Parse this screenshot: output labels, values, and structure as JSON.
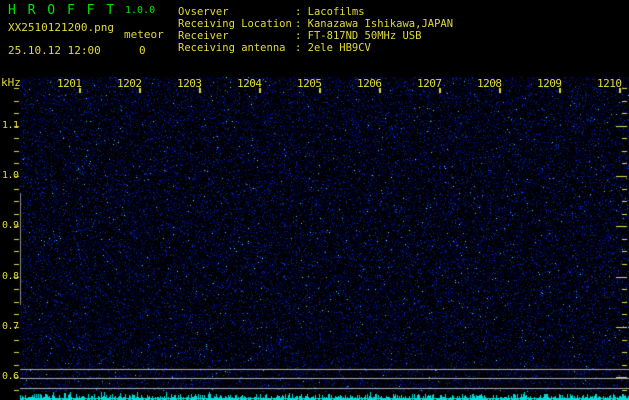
{
  "app": {
    "title": "H R O F F T",
    "version": "1.0.0",
    "filename": "XX2510121200.png",
    "mode": "meteor",
    "datetime": "25.10.12 12:00",
    "count": "0"
  },
  "info": {
    "rows": [
      {
        "label": "Ovserver",
        "sep": ":",
        "value": "Lacofilms"
      },
      {
        "label": "Receiving Location",
        "sep": ":",
        "value": "Kanazawa Ishikawa,JAPAN"
      },
      {
        "label": "Receiver",
        "sep": ":",
        "value": "FT-817ND 50MHz USB"
      },
      {
        "label": "Receiving antenna",
        "sep": ":",
        "value": "2ele HB9CV"
      }
    ]
  },
  "spectrogram": {
    "unit_label": "kHz",
    "time_labels": [
      "1201",
      "1202",
      "1203",
      "1204",
      "1205",
      "1206",
      "1207",
      "1208",
      "1209",
      "1210"
    ],
    "freq_labels": [
      "1.1",
      "1.0",
      "0.9",
      "0.8",
      "0.7",
      "0.6"
    ]
  },
  "colors": {
    "background": "#000000",
    "text_green": "#00e400",
    "text_yellow": "#e0da3a",
    "noise_blue": "#1818c8",
    "trace_cyan": "#00dcdc",
    "grid_gray": "#aaaaaa",
    "scale_bar_gray": "#8a8a8a"
  }
}
